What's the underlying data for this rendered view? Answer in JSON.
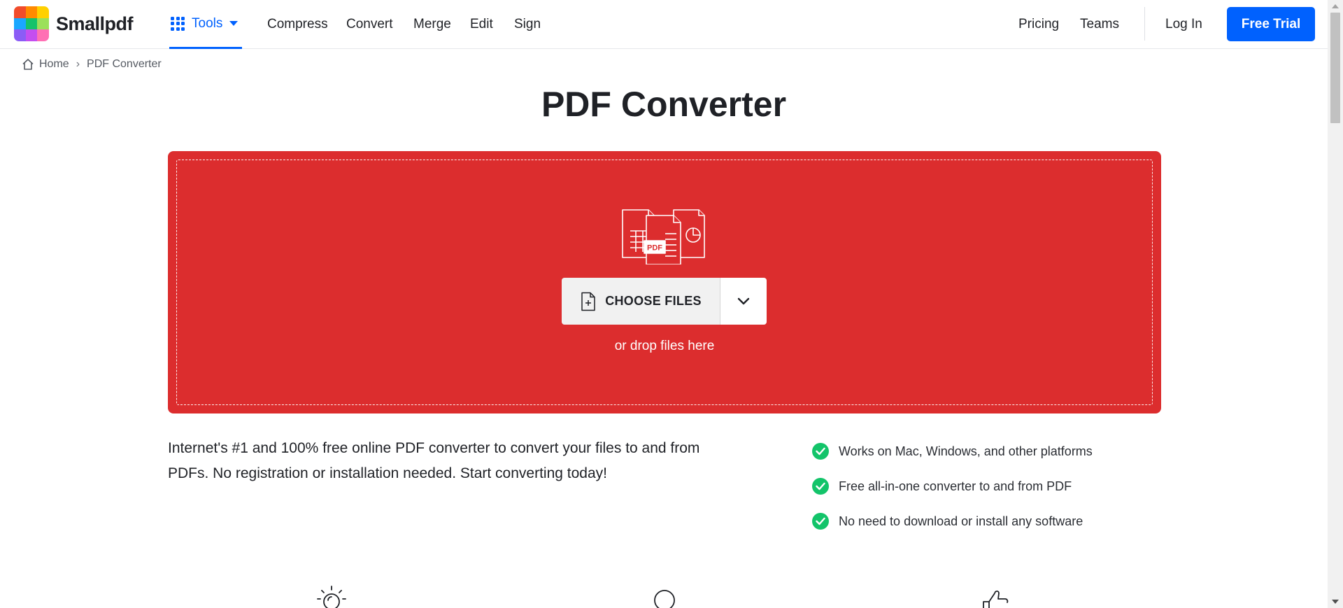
{
  "header": {
    "brand": "Smallpdf",
    "tools_label": "Tools",
    "nav": [
      "Compress",
      "Convert",
      "Merge",
      "Edit",
      "Sign"
    ],
    "right_nav": [
      "Pricing",
      "Teams"
    ],
    "login_label": "Log In",
    "free_trial_label": "Free Trial",
    "accent_color": "#0061fe"
  },
  "breadcrumb": {
    "home": "Home",
    "current": "PDF Converter"
  },
  "main": {
    "title": "PDF Converter",
    "dropzone_color": "#dc2d2e",
    "choose_files_label": "CHOOSE FILES",
    "drop_text": "or drop files here",
    "description": "Internet's #1 and 100% free online PDF converter to convert your files to and from PDFs. No registration or installation needed. Start converting today!",
    "features": [
      "Works on Mac, Windows, and other platforms",
      "Free all-in-one converter to and from PDF",
      "No need to download or install any software"
    ],
    "illustration_badge": "PDF"
  }
}
